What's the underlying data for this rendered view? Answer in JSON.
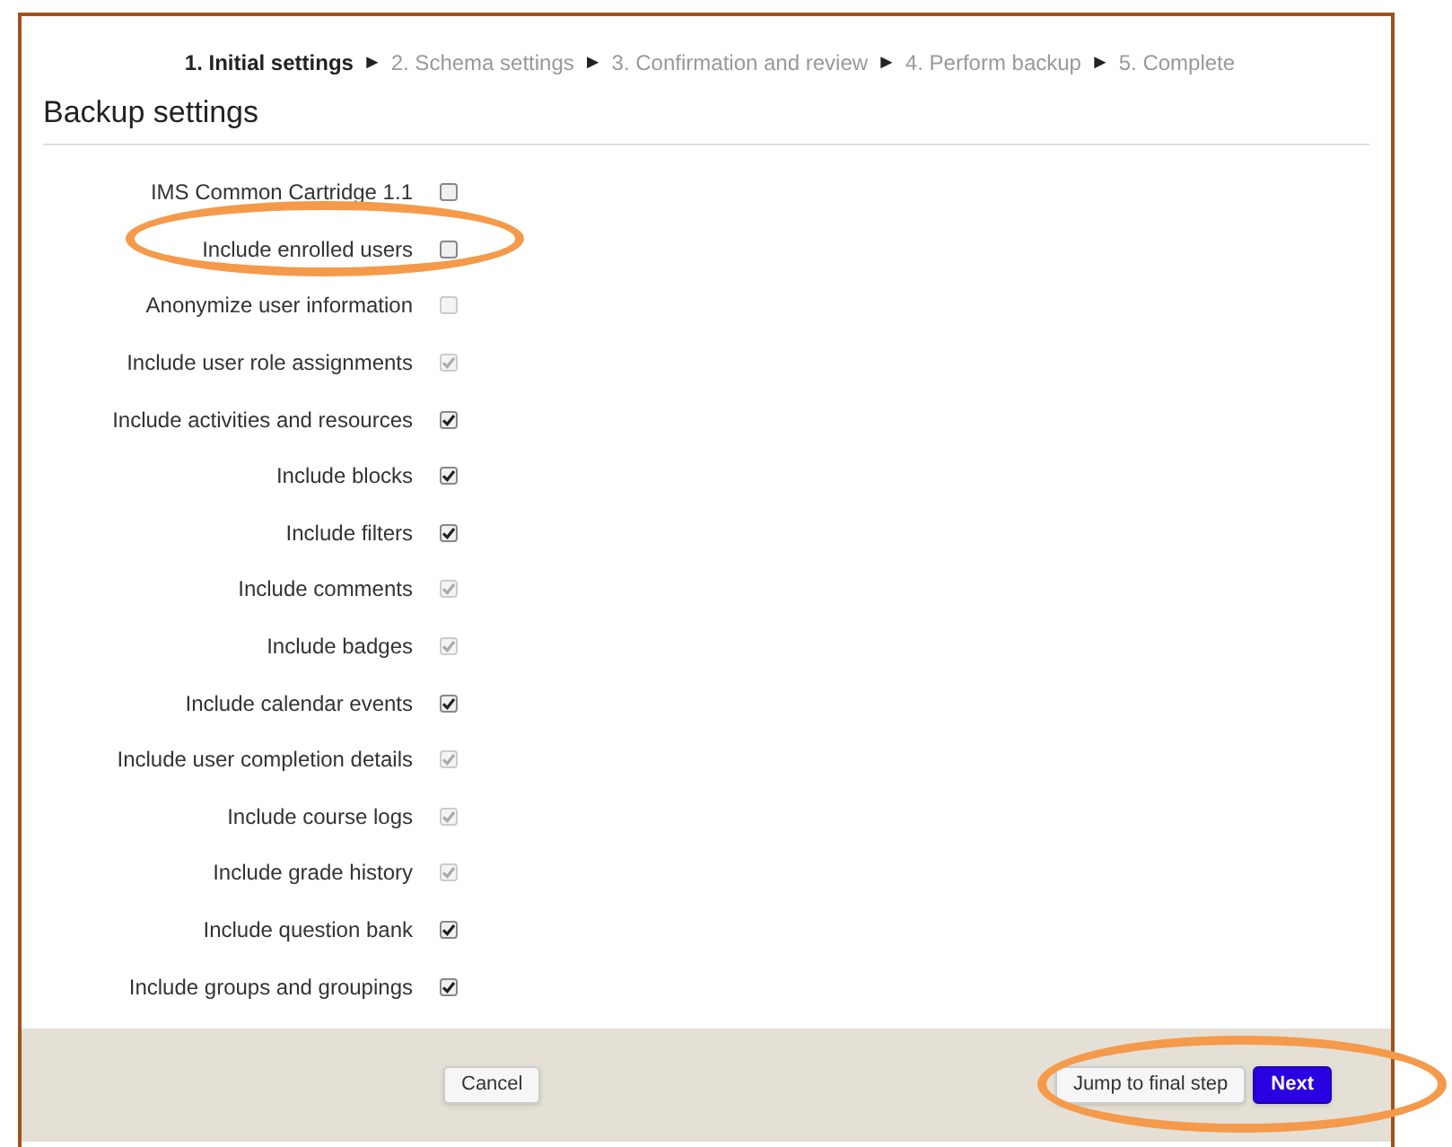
{
  "steps": [
    {
      "kind": "step",
      "label": "1. Initial settings",
      "selected": true
    },
    {
      "kind": "separator",
      "label": "►"
    },
    {
      "kind": "step",
      "label": "2. Schema settings",
      "selected": false
    },
    {
      "kind": "separator",
      "label": "►"
    },
    {
      "kind": "step",
      "label": "3. Confirmation and review",
      "selected": false
    },
    {
      "kind": "separator",
      "label": "►"
    },
    {
      "kind": "step",
      "label": "4. Perform backup",
      "selected": false
    },
    {
      "kind": "separator",
      "label": "►"
    },
    {
      "kind": "step",
      "label": "5. Complete",
      "selected": false
    }
  ],
  "heading": "Backup settings",
  "settings": [
    {
      "label": "IMS Common Cartridge 1.1",
      "checked": false,
      "disabled": false,
      "highlighted": false
    },
    {
      "label": "Include enrolled users",
      "checked": false,
      "disabled": false,
      "highlighted": true
    },
    {
      "label": "Anonymize user information",
      "checked": false,
      "disabled": true,
      "highlighted": false
    },
    {
      "label": "Include user role assignments",
      "checked": true,
      "disabled": true,
      "highlighted": false
    },
    {
      "label": "Include activities and resources",
      "checked": true,
      "disabled": false,
      "highlighted": false
    },
    {
      "label": "Include blocks",
      "checked": true,
      "disabled": false,
      "highlighted": false
    },
    {
      "label": "Include filters",
      "checked": true,
      "disabled": false,
      "highlighted": false
    },
    {
      "label": "Include comments",
      "checked": true,
      "disabled": true,
      "highlighted": false
    },
    {
      "label": "Include badges",
      "checked": true,
      "disabled": true,
      "highlighted": false
    },
    {
      "label": "Include calendar events",
      "checked": true,
      "disabled": false,
      "highlighted": false
    },
    {
      "label": "Include user completion details",
      "checked": true,
      "disabled": true,
      "highlighted": false
    },
    {
      "label": "Include course logs",
      "checked": true,
      "disabled": true,
      "highlighted": false
    },
    {
      "label": "Include grade history",
      "checked": true,
      "disabled": true,
      "highlighted": false
    },
    {
      "label": "Include question bank",
      "checked": true,
      "disabled": false,
      "highlighted": false
    },
    {
      "label": "Include groups and groupings",
      "checked": true,
      "disabled": false,
      "highlighted": false
    }
  ],
  "footer": {
    "cancel": "Cancel",
    "jump": "Jump to final step",
    "next": "Next",
    "highlighted": true
  }
}
